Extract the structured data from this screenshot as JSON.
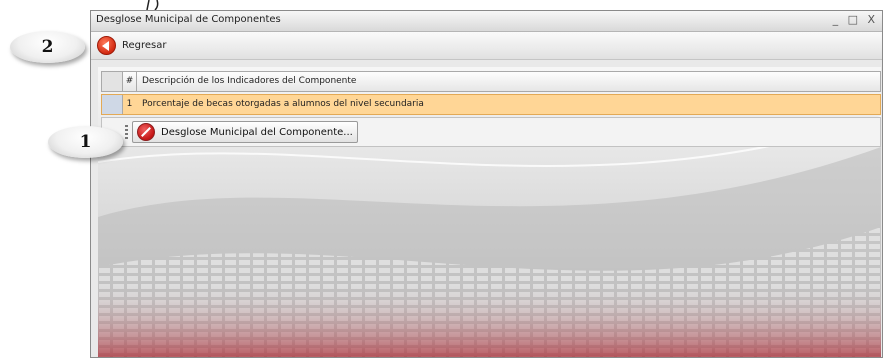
{
  "window": {
    "title": "Desglose Municipal de Componentes",
    "controls": "_ □ X"
  },
  "toolbar": {
    "back_label": "Regresar",
    "back_icon": "back-arrow-red-circle-icon"
  },
  "grid": {
    "headers": {
      "number": "#",
      "description": "Descripción de los Indicadores del Componente"
    },
    "rows": [
      {
        "number": "1",
        "description": "Porcentaje  de becas otorgadas  a alumnos  del nivel secundaria"
      }
    ],
    "selected_row_color": "#ffd696"
  },
  "sub_toolbar": {
    "desglose_label": "Desglose Municipal del Componente...",
    "desglose_icon": "no-entry-red-circle-icon"
  },
  "callouts": [
    {
      "label": "2"
    },
    {
      "label": "1"
    }
  ]
}
